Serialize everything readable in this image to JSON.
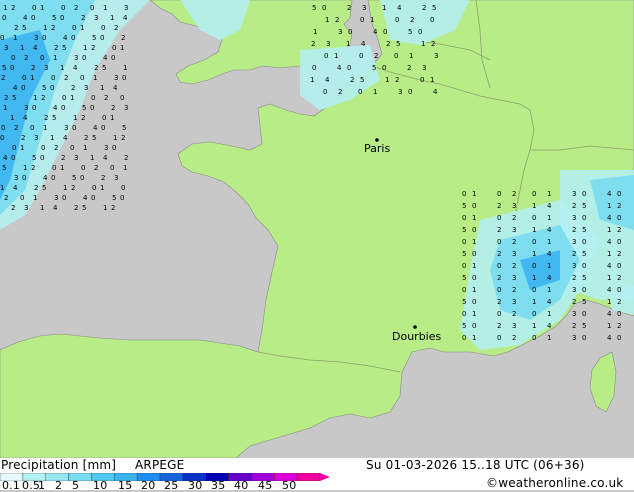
{
  "map": {
    "colors": {
      "sea": "#c8c8c8",
      "land": "#b7ec86",
      "border": "#8aa070",
      "precip_light": "#b4f0f0",
      "precip_mid": "#78dcf0",
      "precip_heavy": "#3cb4f0"
    },
    "cities": [
      {
        "name": "Paris"
      },
      {
        "name": "Dourbies"
      }
    ]
  },
  "legend": {
    "title": "Precipitation [mm]",
    "model": "ARPEGE",
    "datetime": "Su 01-03-2026 15..18 UTC (06+36)",
    "credit": "©weatheronline.co.uk",
    "scale_labels": [
      "0.1",
      "0.5",
      "1",
      "2",
      "5",
      "10",
      "15",
      "20",
      "25",
      "30",
      "35",
      "40",
      "45",
      "50"
    ],
    "scale_colors": [
      "#e6faff",
      "#b4f0f0",
      "#96e6f0",
      "#78dcf0",
      "#50c8f0",
      "#3cb4f0",
      "#1e8cf0",
      "#1464dc",
      "#0a32c8",
      "#0000b4",
      "#6400c8",
      "#a000dc",
      "#dc00dc",
      "#f000a0"
    ]
  }
}
